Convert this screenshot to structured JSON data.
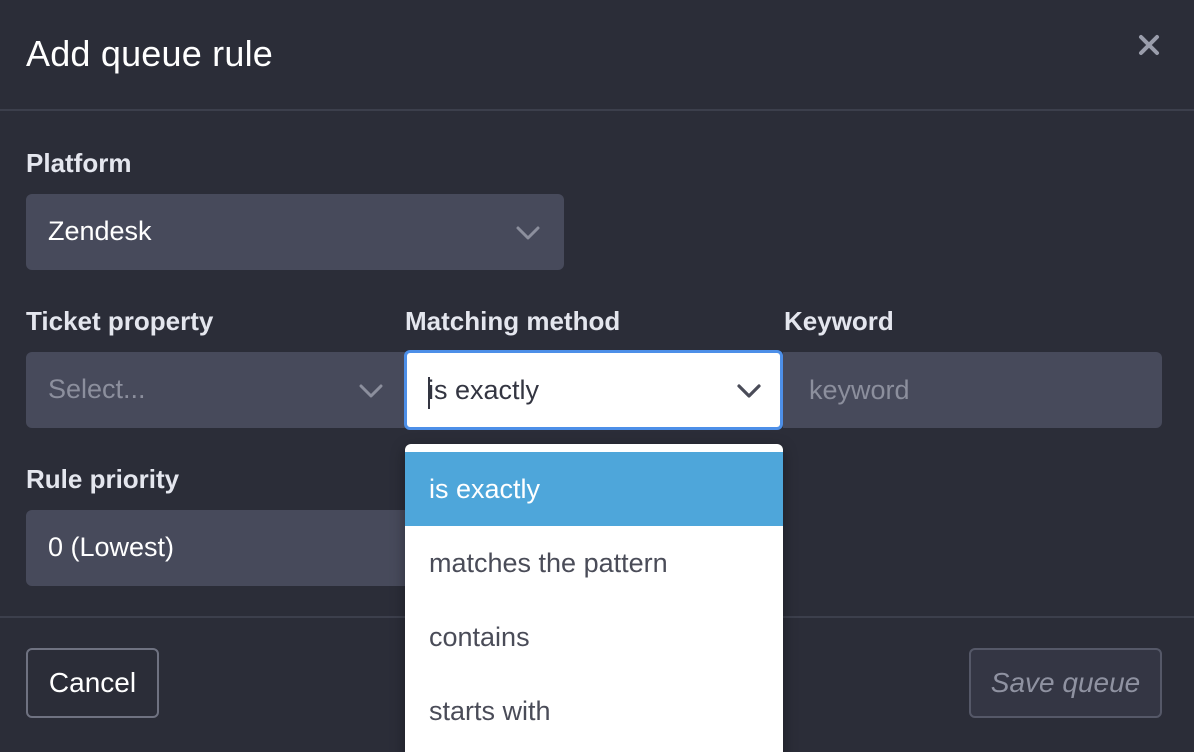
{
  "modal": {
    "title": "Add queue rule",
    "close_icon": "close-icon"
  },
  "platform": {
    "label": "Platform",
    "value": "Zendesk"
  },
  "ticket_property": {
    "label": "Ticket property",
    "placeholder": "Select..."
  },
  "matching_method": {
    "label": "Matching method",
    "value": "is exactly",
    "options": [
      {
        "label": "is exactly",
        "selected": true
      },
      {
        "label": "matches the pattern",
        "selected": false
      },
      {
        "label": "contains",
        "selected": false
      },
      {
        "label": "starts with",
        "selected": false
      }
    ]
  },
  "keyword": {
    "label": "Keyword",
    "placeholder": "keyword",
    "value": ""
  },
  "rule_priority": {
    "label": "Rule priority",
    "value": "0 (Lowest)"
  },
  "footer": {
    "cancel_label": "Cancel",
    "save_label": "Save queue"
  },
  "colors": {
    "background": "#2b2d38",
    "field": "#474a5b",
    "focus_border": "#4d8fe8",
    "selected_option": "#4ea6da"
  }
}
